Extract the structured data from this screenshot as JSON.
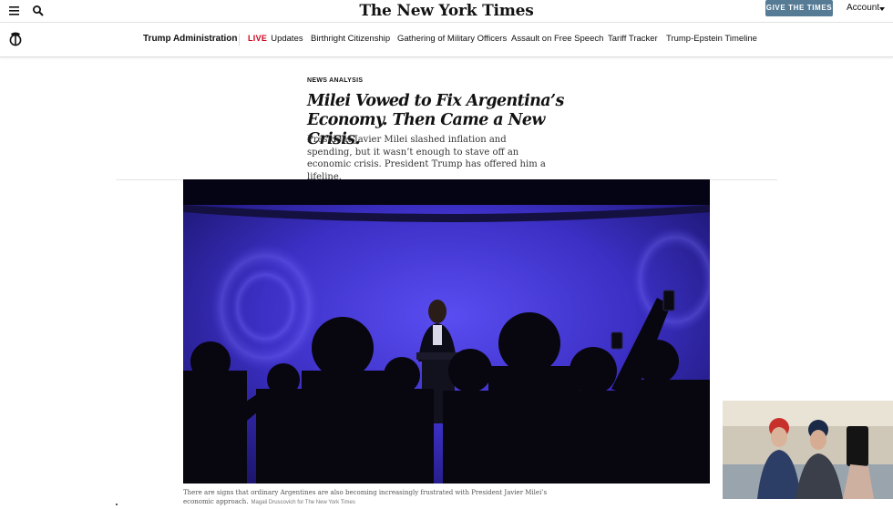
{
  "masthead": {
    "logo": "The New York Times",
    "give_label": "GIVE THE TIMES",
    "account_label": "Account",
    "icons": [
      "menu-icon",
      "search-icon",
      "chevron-down-icon"
    ]
  },
  "nav": {
    "logo_icon": "nyt-t-logo-icon",
    "primary": "Trump Administration",
    "live_tag": "LIVE",
    "items": [
      "Updates",
      "Birthright Citizenship",
      "Gathering of Military Officers",
      "Assault on Free Speech",
      "Tariff Tracker",
      "Trump-Epstein Timeline"
    ],
    "live_color": "#d0021b"
  },
  "article": {
    "kicker": "NEWS ANALYSIS",
    "headline": "Milei Vowed to Fix Argentina’s Economy. Then Came a New Crisis.",
    "dek": "President Javier Milei slashed inflation and spending, but it wasn’t enough to stave off an economic crisis. President Trump has offered him a lifeline.",
    "caption": "There are signs that ordinary Argentines are also becoming increasingly frustrated with President Javier Milei’s economic approach.",
    "credit": "Magali Druscovich for The New York Times"
  },
  "colors": {
    "give_button": "#567b95",
    "stage_blue": "#3b2fc4"
  }
}
